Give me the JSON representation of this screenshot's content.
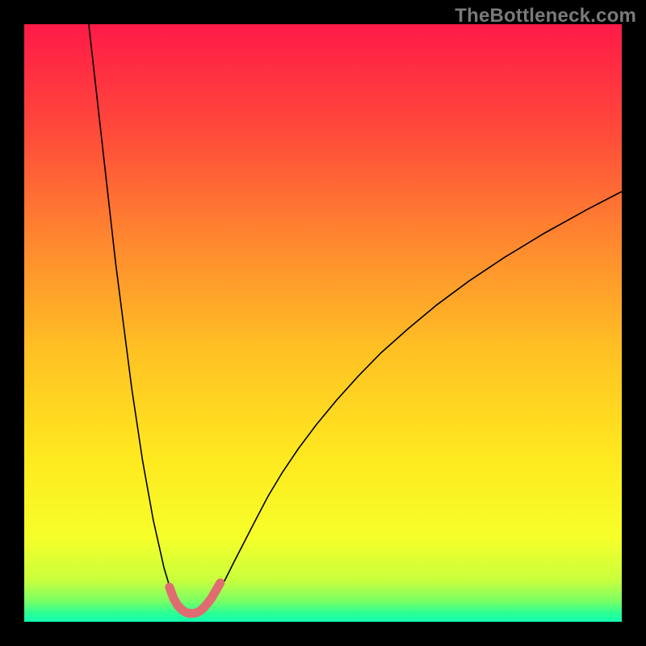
{
  "watermark": "TheBottleneck.com",
  "chart_data": {
    "type": "line",
    "title": "",
    "xlabel": "",
    "ylabel": "",
    "xlim": [
      0,
      100
    ],
    "ylim": [
      0,
      100
    ],
    "grid": false,
    "legend": false,
    "background_gradient": {
      "stops": [
        {
          "offset": 0.0,
          "color": "#ff1a48"
        },
        {
          "offset": 0.18,
          "color": "#ff4a3a"
        },
        {
          "offset": 0.37,
          "color": "#ff8a2f"
        },
        {
          "offset": 0.55,
          "color": "#ffc223"
        },
        {
          "offset": 0.72,
          "color": "#ffe81f"
        },
        {
          "offset": 0.86,
          "color": "#f6ff2a"
        },
        {
          "offset": 0.93,
          "color": "#c9ff3c"
        },
        {
          "offset": 0.965,
          "color": "#7bff63"
        },
        {
          "offset": 0.985,
          "color": "#2cff93"
        },
        {
          "offset": 1.0,
          "color": "#11ffb1"
        }
      ]
    },
    "series": [
      {
        "name": "bottleneck-curve",
        "stroke": "#000000",
        "stroke_width": 1.6,
        "x": [
          10.8,
          11.7,
          12.6,
          13.5,
          14.4,
          15.3,
          16.2,
          17.1,
          18.0,
          18.9,
          19.8,
          20.7,
          21.6,
          22.5,
          23.4,
          24.3,
          25.2,
          26.1,
          27.0,
          27.9,
          28.8,
          29.7,
          30.9,
          32.1,
          33.6,
          35.1,
          36.9,
          38.7,
          40.8,
          43.2,
          45.9,
          48.9,
          52.2,
          55.8,
          59.7,
          64.2,
          69.0,
          74.4,
          80.4,
          87.0,
          94.2,
          100.0
        ],
        "y": [
          100,
          92,
          84,
          76,
          68,
          60,
          53,
          46,
          39,
          33,
          27,
          22,
          17,
          13,
          9,
          6,
          4,
          2.5,
          1.8,
          1.4,
          1.4,
          1.8,
          2.7,
          4.5,
          7,
          10,
          13.5,
          17,
          21,
          25,
          29,
          33,
          37,
          41,
          45,
          49,
          53,
          57,
          61,
          65,
          69,
          72
        ]
      },
      {
        "name": "optimal-range-marker",
        "stroke": "#e06c72",
        "stroke_width": 11,
        "linecap": "round",
        "x": [
          24.3,
          25.0,
          25.7,
          26.4,
          27.0,
          27.6,
          28.2,
          28.8,
          29.4,
          30.0,
          30.6,
          31.3,
          32.0,
          32.8
        ],
        "y": [
          5.8,
          3.9,
          2.7,
          2.0,
          1.6,
          1.4,
          1.4,
          1.5,
          1.8,
          2.3,
          3.0,
          3.9,
          5.1,
          6.5
        ]
      }
    ],
    "annotations": []
  }
}
